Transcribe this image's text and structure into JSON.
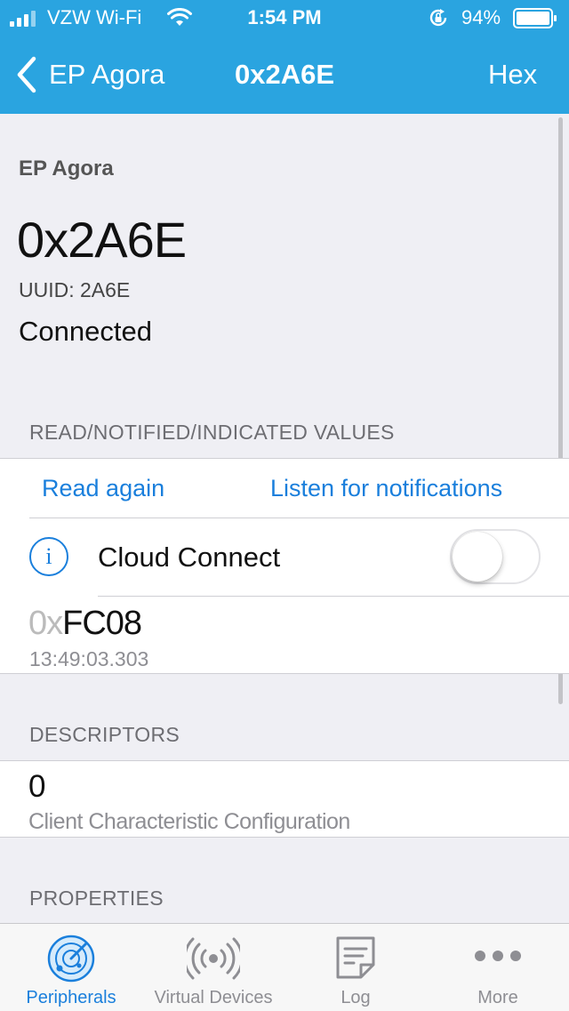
{
  "status_bar": {
    "carrier": "VZW Wi-Fi",
    "time": "1:54 PM",
    "battery": "94%"
  },
  "nav": {
    "back_label": "EP Agora",
    "title": "0x2A6E",
    "right_button": "Hex"
  },
  "header": {
    "peripheral": "EP Agora",
    "characteristic": "0x2A6E",
    "uuid": "UUID: 2A6E",
    "status": "Connected"
  },
  "values_section": {
    "header": "READ/NOTIFIED/INDICATED VALUES",
    "read_again": "Read again",
    "listen": "Listen for notifications",
    "cloud_connect": "Cloud Connect",
    "cloud_connect_on": false,
    "value_prefix": "0x",
    "value_hex": "FC08",
    "value_time": "13:49:03.303"
  },
  "descriptors_section": {
    "header": "DESCRIPTORS",
    "items": [
      {
        "value": "0",
        "name": "Client Characteristic Configuration"
      }
    ]
  },
  "properties_section": {
    "header": "PROPERTIES"
  },
  "tabs": [
    {
      "label": "Peripherals",
      "icon": "radar-icon",
      "active": true
    },
    {
      "label": "Virtual Devices",
      "icon": "broadcast-icon",
      "active": false
    },
    {
      "label": "Log",
      "icon": "log-icon",
      "active": false
    },
    {
      "label": "More",
      "icon": "more-icon",
      "active": false
    }
  ],
  "colors": {
    "accent": "#2aa4e0",
    "link": "#1a7fdc"
  }
}
